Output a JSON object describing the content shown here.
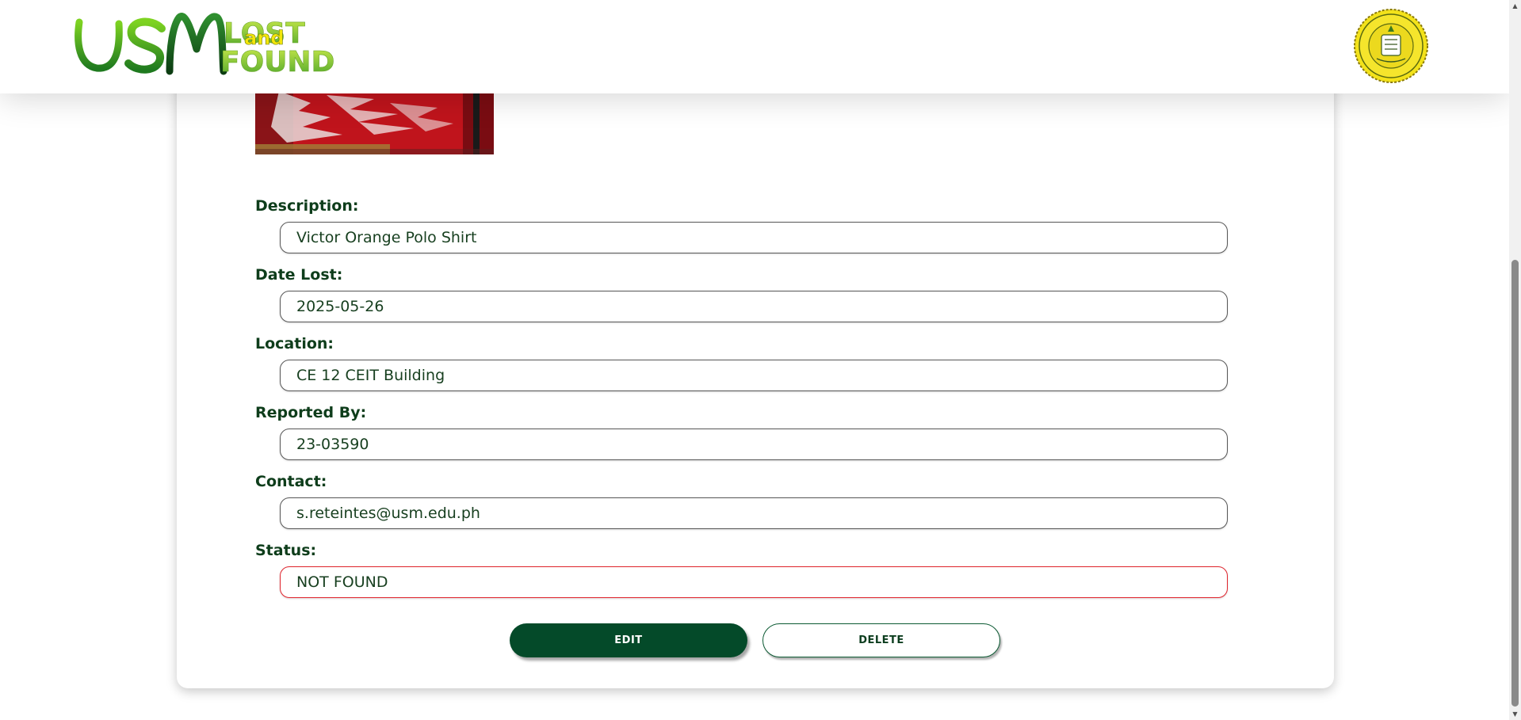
{
  "header": {
    "logo_text": "USM LOST and FOUND",
    "seal_text": "UNIVERSITY OF SOUTHERN MINDANAO"
  },
  "item": {
    "image_alt": "red shirt photo"
  },
  "fields": {
    "description_label": "Description:",
    "description_value": "Victor Orange Polo Shirt",
    "date_lost_label": "Date Lost:",
    "date_lost_value": "2025-05-26",
    "location_label": "Location:",
    "location_value": "CE 12 CEIT Building",
    "reported_by_label": "Reported By:",
    "reported_by_value": "23-03590",
    "contact_label": "Contact:",
    "contact_value": "s.reteintes@usm.edu.ph",
    "status_label": "Status:",
    "status_value": "NOT FOUND"
  },
  "actions": {
    "edit_label": "EDIT",
    "delete_label": "DELETE"
  },
  "colors": {
    "primary_green": "#044a29",
    "label_green": "#0e3d1b",
    "status_red": "#e0242c"
  },
  "icons": {
    "scroll_up": "scroll-up-arrow-icon",
    "scroll_down": "scroll-down-arrow-icon"
  }
}
